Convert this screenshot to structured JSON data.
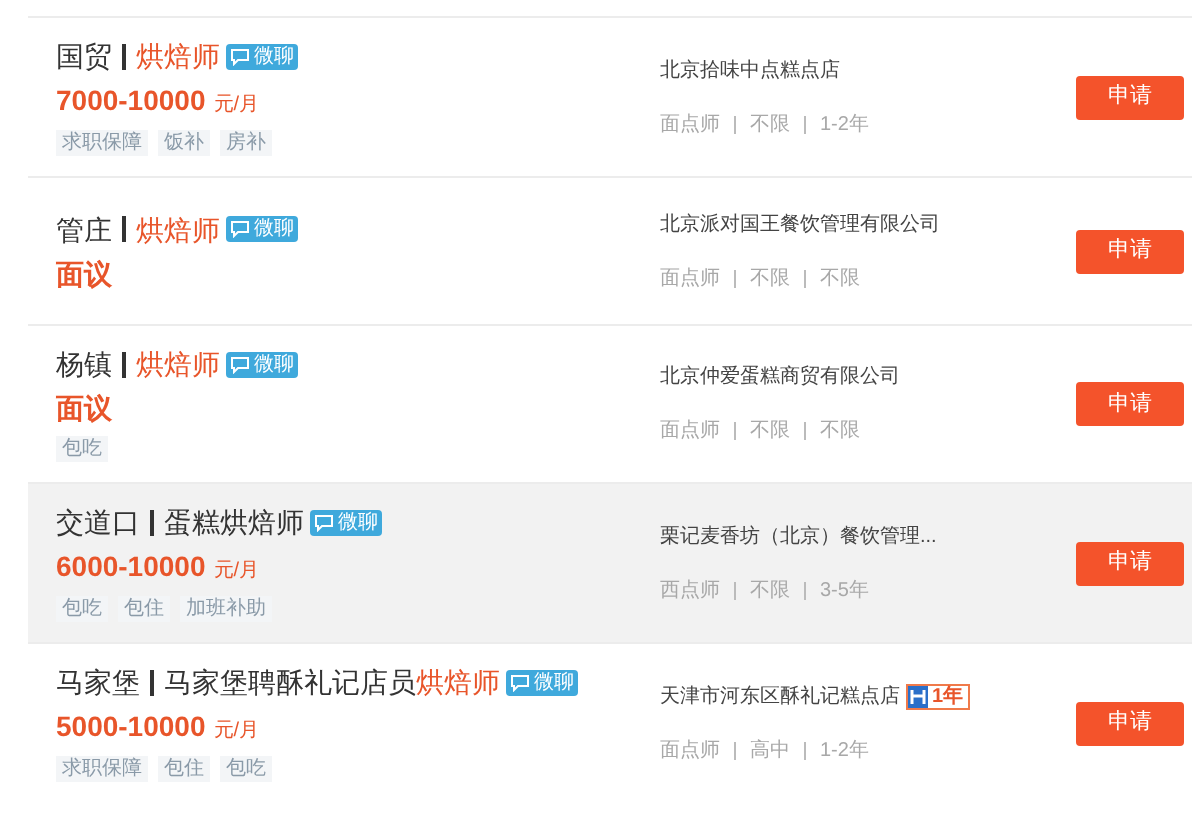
{
  "jobs": [
    {
      "location": "国贸",
      "title_segments": [
        {
          "text": "烘焙师",
          "highlight": true
        }
      ],
      "chat_badge": "微聊",
      "salary": "7000-10000",
      "salary_unit": "元/月",
      "tags": [
        "求职保障",
        "饭补",
        "房补"
      ],
      "company": "北京拾味中点糕点店",
      "meta": [
        "面点师",
        "不限",
        "1-2年"
      ],
      "apply": "申请",
      "selected": false
    },
    {
      "location": "管庄",
      "title_segments": [
        {
          "text": "烘焙师",
          "highlight": true
        }
      ],
      "chat_badge": "微聊",
      "salary": "面议",
      "company": "北京派对国王餐饮管理有限公司",
      "meta": [
        "面点师",
        "不限",
        "不限"
      ],
      "apply": "申请",
      "selected": false
    },
    {
      "location": "杨镇",
      "title_segments": [
        {
          "text": "烘焙师",
          "highlight": true
        }
      ],
      "chat_badge": "微聊",
      "salary": "面议",
      "tags": [
        "包吃"
      ],
      "company": "北京仲爱蛋糕商贸有限公司",
      "meta": [
        "面点师",
        "不限",
        "不限"
      ],
      "apply": "申请",
      "selected": false
    },
    {
      "location": "交道口",
      "title_segments": [
        {
          "text": "蛋糕烘焙师",
          "highlight": false
        }
      ],
      "chat_badge": "微聊",
      "salary": "6000-10000",
      "salary_unit": "元/月",
      "tags": [
        "包吃",
        "包住",
        "加班补助"
      ],
      "company": "栗记麦香坊（北京）餐饮管理...",
      "meta": [
        "西点师",
        "不限",
        "3-5年"
      ],
      "apply": "申请",
      "selected": true
    },
    {
      "location": "马家堡",
      "title_segments": [
        {
          "text": "马家堡聘酥礼记店员",
          "highlight": false
        },
        {
          "text": "烘焙师",
          "highlight": true
        }
      ],
      "chat_badge": "微聊",
      "salary": "5000-10000",
      "salary_unit": "元/月",
      "tags": [
        "求职保障",
        "包住",
        "包吃"
      ],
      "company": "天津市河东区酥礼记糕点店",
      "company_badge": "1年",
      "meta": [
        "面点师",
        "高中",
        "1-2年"
      ],
      "apply": "申请",
      "selected": false
    }
  ]
}
